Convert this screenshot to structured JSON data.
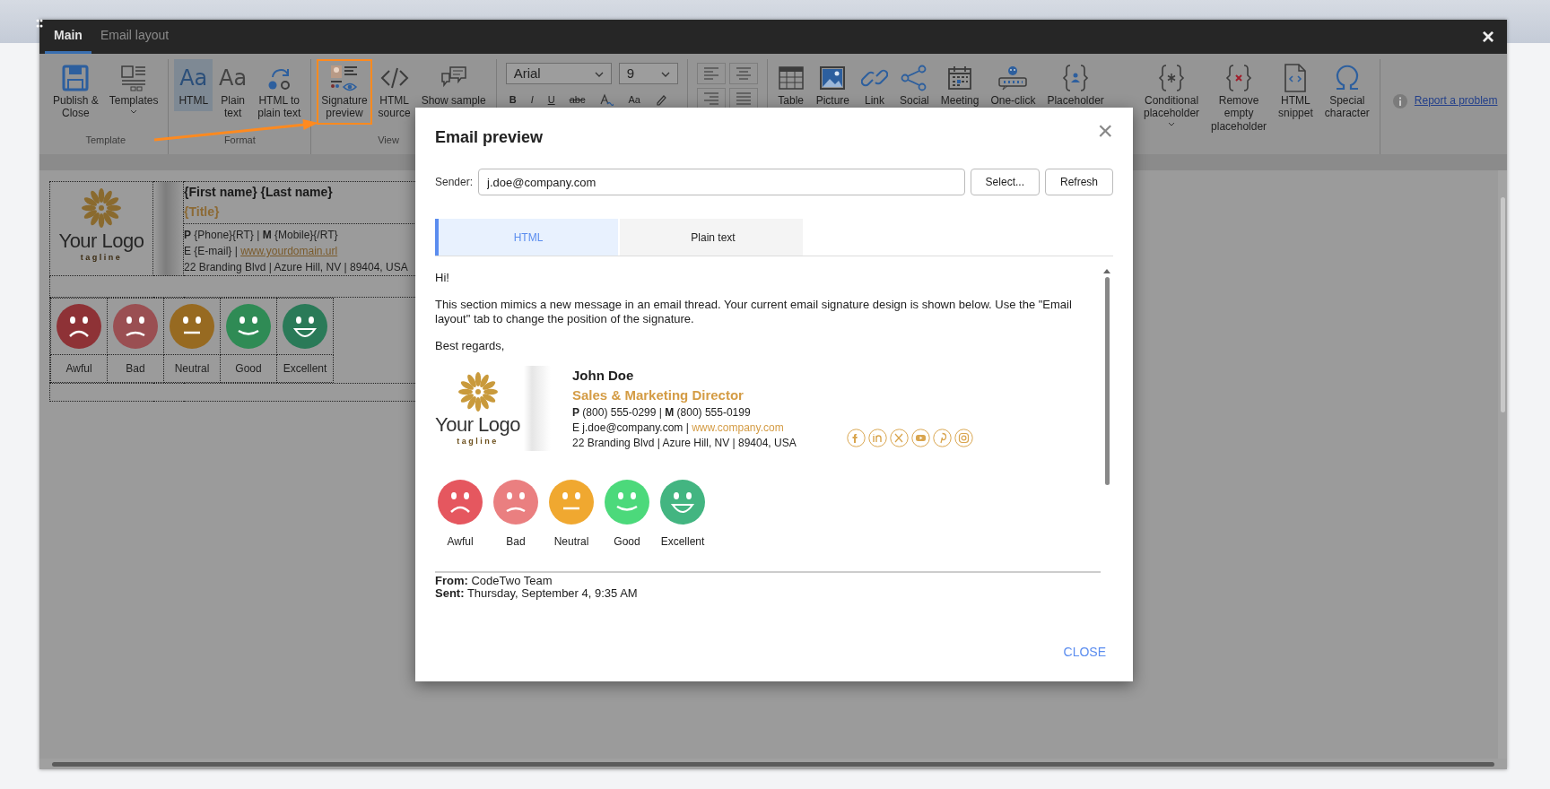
{
  "window": {
    "tabs": [
      {
        "label": "Main",
        "selected": true
      },
      {
        "label": "Email layout",
        "selected": false
      }
    ],
    "close": "×"
  },
  "ribbon": {
    "groups": [
      {
        "label": "Template",
        "items": [
          {
            "kind": "publish",
            "label": "Publish &\nClose"
          },
          {
            "kind": "templates",
            "label": "Templates",
            "dropdown": true
          }
        ]
      },
      {
        "label": "Format",
        "items": [
          {
            "kind": "html",
            "glyph": "Aa",
            "label": "HTML",
            "selected": true
          },
          {
            "kind": "plain",
            "glyph": "Aa",
            "label": "Plain\ntext",
            "selected": false
          },
          {
            "kind": "convert",
            "label": "HTML to\nplain text",
            "selected": false
          }
        ]
      },
      {
        "label": "View",
        "items": [
          {
            "kind": "sigpreview",
            "label": "Signature\npreview",
            "highlighted": true
          },
          {
            "kind": "source",
            "label": "HTML\nsource",
            "highlighted": false
          },
          {
            "kind": "sample",
            "label": "Show sample",
            "highlighted": false
          }
        ]
      }
    ],
    "font": {
      "family": "Arial",
      "size": "9",
      "buttons": [
        {
          "kind": "bold",
          "glyph": "B"
        },
        {
          "kind": "italic",
          "glyph": "I"
        },
        {
          "kind": "underline",
          "glyph": "U"
        },
        {
          "kind": "strike",
          "glyph": "abc"
        },
        {
          "kind": "fontcolor"
        },
        {
          "kind": "case",
          "glyph": "Aa"
        },
        {
          "kind": "highlight"
        }
      ]
    },
    "insert": [
      {
        "kind": "table",
        "label": "Table"
      },
      {
        "kind": "picture",
        "label": "Picture"
      },
      {
        "kind": "link",
        "label": "Link"
      },
      {
        "kind": "social",
        "label": "Social"
      },
      {
        "kind": "meeting",
        "label": "Meeting"
      },
      {
        "kind": "oneclick",
        "label": "One-click"
      },
      {
        "kind": "placeholder",
        "label": "Placeholder"
      },
      {
        "kind": "conditional",
        "label": "Conditional\nplaceholder",
        "dropdown": true
      },
      {
        "kind": "remove",
        "label": "Remove\nempty\nplaceholder"
      },
      {
        "kind": "snippet",
        "label": "HTML\nsnippet"
      },
      {
        "kind": "special",
        "label": "Special\ncharacter"
      }
    ],
    "report_link": "Report a problem"
  },
  "document": {
    "signature": {
      "logo_text": "Your Logo",
      "tagline": "tagline",
      "name": "{First name} {Last name}",
      "title": "{Title}",
      "phone_line": "**P** {Phone}{RT} | **M** {Mobile}{/RT}",
      "email_prefix": "E {E-mail} | ",
      "website": "www.yourdomain.url",
      "address": "22 Branding Blvd | Azure Hill, NV | 89404, USA"
    },
    "ratings": [
      {
        "kind": "awful",
        "label": "Awful",
        "color": "#8e3236"
      },
      {
        "kind": "bad",
        "label": "Bad",
        "color": "#9a4f52"
      },
      {
        "kind": "neutral",
        "label": "Neutral",
        "color": "#976a21"
      },
      {
        "kind": "good",
        "label": "Good",
        "color": "#2f8b55"
      },
      {
        "kind": "excellent",
        "label": "Excellent",
        "color": "#2a7a58"
      }
    ]
  },
  "preview": {
    "title": "Email preview",
    "close": "×",
    "sender_label": "Sender:",
    "sender": "j.doe@company.com",
    "buttons": [
      "Select...",
      "Refresh"
    ],
    "tabs": [
      {
        "label": "HTML",
        "selected": true
      },
      {
        "label": "Plain text",
        "selected": false
      }
    ],
    "body": [
      "Hi!",
      "This section mimics a new message in an email thread. Your current email signature design is shown below. Use the \"Email layout\" tab to change the position of the signature.",
      "Best regards,"
    ],
    "signature": {
      "logo_text": "Your Logo",
      "tagline": "tagline",
      "name": "John Doe",
      "title": "Sales & Marketing Director",
      "phone_line": "**P** (800) 555-0299 | **M** (800) 555-0199",
      "email_prefix": "E j.doe@company.com | ",
      "website": "www.company.com",
      "address": "22 Branding Blvd | Azure Hill, NV | 89404, USA"
    },
    "ratings": [
      {
        "kind": "awful",
        "label": "Awful",
        "color": "#e5575f"
      },
      {
        "kind": "bad",
        "label": "Bad",
        "color": "#ea7f80"
      },
      {
        "kind": "neutral",
        "label": "Neutral",
        "color": "#f0a830"
      },
      {
        "kind": "good",
        "label": "Good",
        "color": "#4cd97b"
      },
      {
        "kind": "excellent",
        "label": "Excellent",
        "color": "#43b581"
      }
    ],
    "reply_header": [
      "**From:** CodeTwo Team",
      "**Sent:** Thursday, September 4, 9:35 AM"
    ],
    "footer_button": "CLOSE"
  }
}
